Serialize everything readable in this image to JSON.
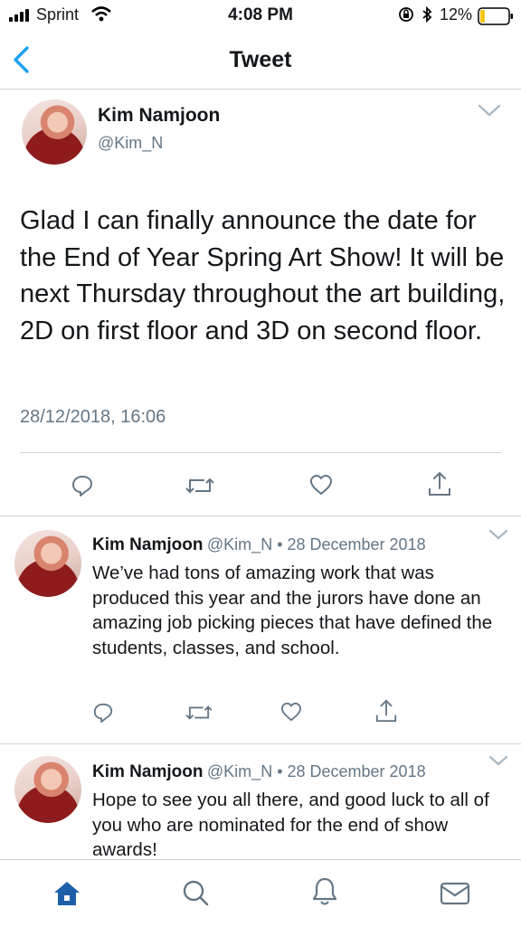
{
  "status_bar": {
    "carrier": "Sprint",
    "time": "4:08 PM",
    "battery": "12%"
  },
  "nav": {
    "title": "Tweet"
  },
  "main_tweet": {
    "name": "Kim Namjoon",
    "handle": "@Kim_N",
    "text": "Glad I can finally announce the date for the End of Year Spring Art Show! It will be next Thursday throughout the art building, 2D on first floor and 3D on second floor.",
    "date": "28/12/2018, 16:06"
  },
  "replies": [
    {
      "name": "Kim Namjoon",
      "meta": "@Kim_N • 28 December 2018",
      "text": "We’ve had tons of amazing work that was produced this year and the jurors have done an amazing job picking pieces that have defined the students, classes, and school."
    },
    {
      "name": "Kim Namjoon",
      "meta": "@Kim_N • 28 December 2018",
      "text": "Hope to see you all there, and good luck to all of you who are nominated for the end of show awards!"
    }
  ],
  "icons": {
    "back": "back-chevron-icon",
    "more": "chevron-down-icon",
    "reply": "reply-icon",
    "retweet": "retweet-icon",
    "like": "heart-icon",
    "share": "share-icon",
    "tabs": [
      "home-icon",
      "search-icon",
      "notifications-icon",
      "messages-icon"
    ]
  },
  "colors": {
    "accent": "#1da1f2",
    "text": "#14171a",
    "muted": "#657786",
    "divider": "#cfd4d8",
    "battery": "#f5c518"
  }
}
